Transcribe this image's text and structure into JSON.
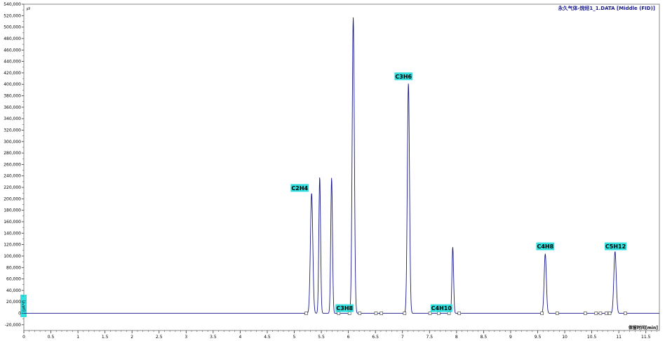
{
  "chart_data": {
    "type": "line",
    "title": "永久气体-烷烃1_1.DATA [Middle (FID)]",
    "ylabel": "[pA*s]",
    "corner_mark": "㎶",
    "xlabel": "保留时间[min]",
    "xlim": [
      0,
      11.75
    ],
    "ylim": [
      -30000,
      540000
    ],
    "x_ticks": [
      0,
      0.5,
      1,
      1.5,
      2,
      2.5,
      3,
      3.5,
      4,
      4.5,
      5,
      5.5,
      6,
      6.5,
      7,
      7.5,
      8,
      8.5,
      9,
      9.5,
      10,
      10.5,
      11,
      11.5
    ],
    "x_tick_labels": [
      "0",
      "0.5",
      "1",
      "1.5",
      "2",
      "2.5",
      "3",
      "3.5",
      "4",
      "4.5",
      "5",
      "5.5",
      "6",
      "6.5",
      "7",
      "7.5",
      "8",
      "8.5",
      "9",
      "9.5",
      "10",
      "10.5",
      "11",
      "11.5"
    ],
    "y_ticks": [
      -20000,
      0,
      20000,
      40000,
      60000,
      80000,
      100000,
      120000,
      140000,
      160000,
      180000,
      200000,
      220000,
      240000,
      260000,
      280000,
      300000,
      320000,
      340000,
      360000,
      380000,
      400000,
      420000,
      440000,
      460000,
      480000,
      500000,
      520000,
      540000
    ],
    "y_tick_labels": [
      "-20,000",
      "0",
      "20,000",
      "40,000",
      "60,000",
      "80,000",
      "100,000",
      "120,000",
      "140,000",
      "160,000",
      "180,000",
      "200,000",
      "220,000",
      "240,000",
      "260,000",
      "280,000",
      "300,000",
      "320,000",
      "340,000",
      "360,000",
      "380,000",
      "400,000",
      "420,000",
      "440,000",
      "460,000",
      "480,000",
      "500,000",
      "520,000",
      "540,000"
    ],
    "grid": false,
    "line_color": "#1a1a8c",
    "label_color": "#33e0e0",
    "peaks": [
      {
        "rt": 5.32,
        "height": 210000,
        "width": 0.022
      },
      {
        "rt": 5.47,
        "height": 238000,
        "width": 0.016
      },
      {
        "rt": 5.69,
        "height": 237000,
        "width": 0.016
      },
      {
        "rt": 6.09,
        "height": 517000,
        "width": 0.02
      },
      {
        "rt": 7.11,
        "height": 402000,
        "width": 0.02
      },
      {
        "rt": 7.93,
        "height": 116000,
        "width": 0.015
      },
      {
        "rt": 9.64,
        "height": 104000,
        "width": 0.02
      },
      {
        "rt": 10.93,
        "height": 108000,
        "width": 0.022
      }
    ],
    "peak_labels": [
      {
        "text": "C2H4",
        "x": 5.1,
        "y": 219000
      },
      {
        "text": "C3H8",
        "x": 5.93,
        "y": 9000
      },
      {
        "text": "C3H6",
        "x": 7.02,
        "y": 414000
      },
      {
        "text": "C4H10",
        "x": 7.72,
        "y": 9000
      },
      {
        "text": "C4H8",
        "x": 9.64,
        "y": 117000
      },
      {
        "text": "C5H12",
        "x": 10.94,
        "y": 117000
      }
    ],
    "baseline_markers": [
      5.22,
      5.82,
      6.02,
      6.21,
      6.51,
      6.61,
      7.04,
      7.51,
      7.67,
      7.86,
      8.05,
      9.58,
      9.86,
      10.38,
      10.58,
      10.66,
      10.77,
      10.83,
      11.12
    ]
  }
}
